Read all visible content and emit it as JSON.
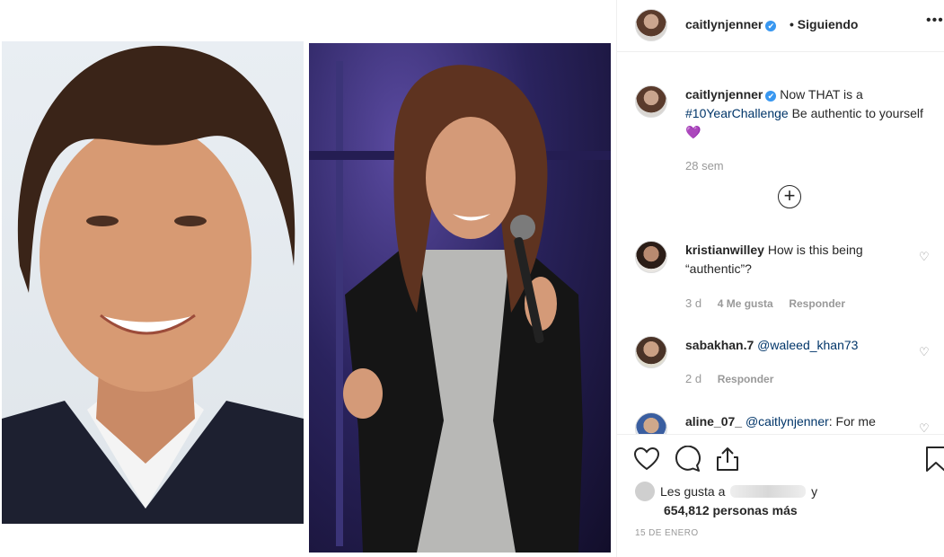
{
  "header": {
    "username": "caitlynjenner",
    "verified_mark": "✔",
    "follow_label": "• Siguiendo",
    "more_label": "•••"
  },
  "caption": {
    "username": "caitlynjenner",
    "text_before": "Now THAT is a",
    "hashtag": "#10YearChallenge",
    "text_after": "Be authentic to yourself",
    "emoji": "💜",
    "time": "28 sem"
  },
  "load_more_icon": "plus-circle-icon",
  "comments": [
    {
      "username": "kristianwilley",
      "text": "How is this being “authentic”?",
      "time": "3 d",
      "likes": "4 Me gusta",
      "reply": "Responder"
    },
    {
      "username": "sabakhan.7",
      "mention": "@waleed_khan73",
      "text": "",
      "time": "2 d",
      "reply": "Responder"
    },
    {
      "username": "aline_07_",
      "mention": "@caitlynjenner",
      "text": ": For me"
    }
  ],
  "actions": {
    "like_icon": "heart-icon",
    "comment_icon": "comment-icon",
    "share_icon": "share-icon",
    "save_icon": "bookmark-icon"
  },
  "likes": {
    "prefix": "Les gusta a",
    "suffix": "y",
    "count_text": "654,812 personas más"
  },
  "date": "15 DE ENERO",
  "colors": {
    "verified": "#3897f0",
    "link": "#003569",
    "muted": "#999999",
    "border": "#efefef"
  }
}
